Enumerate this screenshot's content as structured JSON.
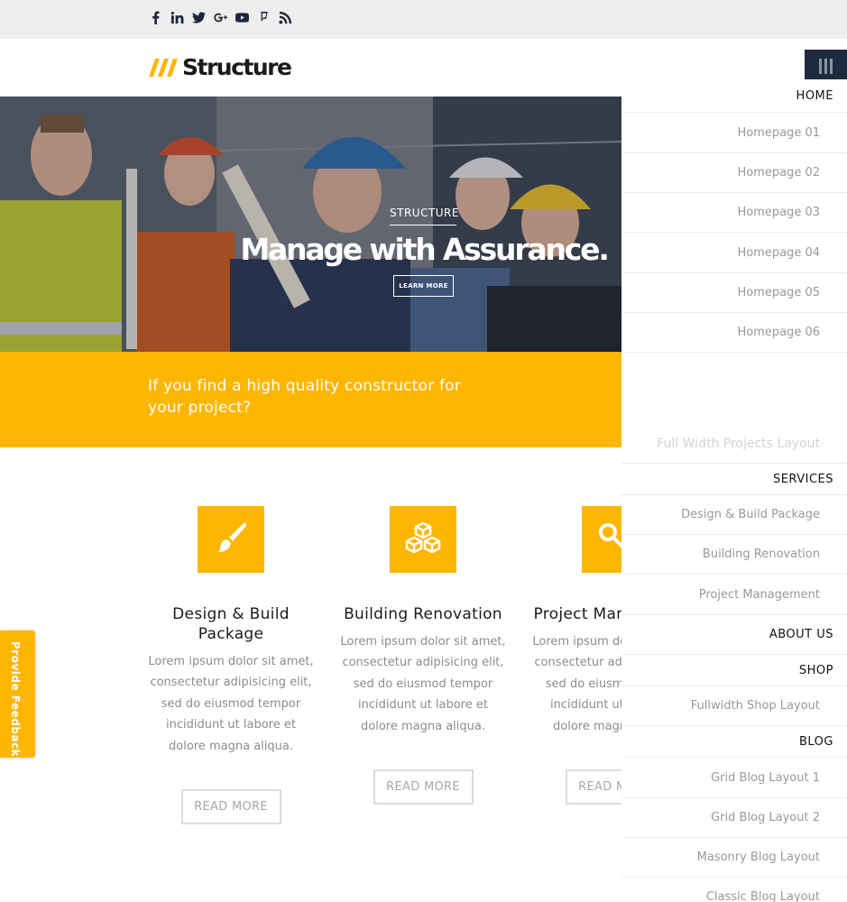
{
  "topbar": {
    "social_icons": [
      "facebook-icon",
      "linkedin-icon",
      "twitter-icon",
      "google-plus-icon",
      "youtube-icon",
      "foursquare-icon",
      "rss-icon"
    ]
  },
  "header": {
    "logo_text": "Structure",
    "menu_icon": "menu-icon"
  },
  "hero": {
    "tag": "STRUCTURE",
    "title": "Manage with Assurance.",
    "button_label": "LEARN MORE"
  },
  "band": {
    "text": "If you find a high quality constructor for your project?"
  },
  "features": [
    {
      "icon": "paintbrush-icon",
      "title": "Design  & Build Package",
      "text": "Lorem ipsum dolor sit amet, consectetur adipisicing elit, sed do eiusmod tempor incididunt ut labore et dolore magna aliqua.",
      "button": "READ MORE"
    },
    {
      "icon": "cubes-icon",
      "title": "Building Renovation",
      "text": "Lorem ipsum dolor sit amet, consectetur adipisicing elit, sed do eiusmod tempor incididunt ut labore et dolore magna aliqua.",
      "button": "READ MORE"
    },
    {
      "icon": "key-icon",
      "title": "Project Management",
      "text": "Lorem ipsum dolor sit amet, consectetur adipisicing elit, sed do eiusmod tempor incididunt ut labore et dolore magna aliqua.",
      "button": "READ MORE"
    }
  ],
  "sidenav": {
    "home": "HOME",
    "home_items": [
      "Homepage 01",
      "Homepage 02",
      "Homepage 03",
      "Homepage 04",
      "Homepage 05",
      "Homepage 06"
    ],
    "hidden_item": "Full Width Projects Layout",
    "services": "SERVICES",
    "services_items": [
      "Design & Build Package",
      "Building Renovation",
      "Project Management"
    ],
    "about": "ABOUT US",
    "shop": "SHOP",
    "shop_items": [
      "Fullwidth Shop Layout"
    ],
    "blog": "BLOG",
    "blog_items": [
      "Grid Blog Layout 1",
      "Grid Blog Layout 2",
      "Masonry Blog Layout",
      "Classic Blog Layout"
    ]
  },
  "feedback": {
    "label": "Provide Feedback"
  },
  "colors": {
    "accent": "#ffb600",
    "navy": "#1e2a3e",
    "topbar": "#eeeeee"
  }
}
